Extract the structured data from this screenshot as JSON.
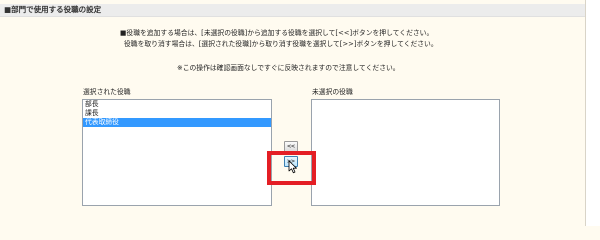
{
  "section": {
    "title": "■部門で使用する役職の設定"
  },
  "instructions": {
    "line1": "■役職を追加する場合は、[未選択の役職]から追加する役職を選択して[<<]ボタンを押してください。",
    "line2": "役職を取り消す場合は、[選択された役職]から取り消す役職を選択して[>>]ボタンを押してください。",
    "note": "※この操作は確認画面なしですぐに反映されますので注意してください。"
  },
  "selected_list": {
    "label": "選択された役職",
    "items": [
      {
        "label": "部長"
      },
      {
        "label": "課長"
      },
      {
        "label": "代表取締役",
        "active": true
      }
    ]
  },
  "unselected_list": {
    "label": "未選択の役職",
    "items": []
  },
  "buttons": {
    "add_label": "<<",
    "remove_label": ">>"
  },
  "annotation": {
    "highlight_color": "#e41e24"
  }
}
